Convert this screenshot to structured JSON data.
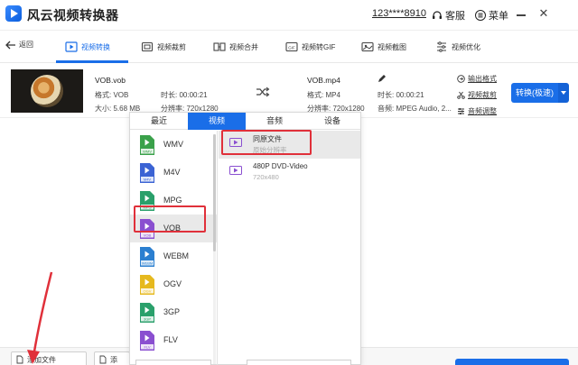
{
  "app": {
    "title": "风云视频转换器",
    "user_phone": "123****8910",
    "support_label": "客服",
    "menu_label": "菜单"
  },
  "toolbar": {
    "back_label": "返回",
    "items": [
      {
        "label": "视频转换",
        "icon": "video-convert-icon",
        "active": true
      },
      {
        "label": "视频裁剪",
        "icon": "video-crop-icon"
      },
      {
        "label": "视频合并",
        "icon": "video-merge-icon"
      },
      {
        "label": "视频转GIF",
        "icon": "gif-icon"
      },
      {
        "label": "视频截图",
        "icon": "screenshot-icon"
      },
      {
        "label": "视频优化",
        "icon": "optimize-icon"
      }
    ]
  },
  "file": {
    "source_name": "VOB.vob",
    "source_format": "格式: VOB",
    "source_duration": "时长: 00:00:21",
    "source_size": "大小: 5.68 MB",
    "source_resolution": "分辨率: 720x1280",
    "target_name": "VOB.mp4",
    "target_format": "格式: MP4",
    "target_duration": "时长: 00:00:21",
    "target_resolution": "分辨率: 720x1280",
    "target_audio": "音频: MPEG Audio, 2..."
  },
  "side_links": {
    "output_format": "输出格式",
    "video_crop": "视频裁剪",
    "audio_adjust": "音频调整"
  },
  "convert_button": "转换(极速)",
  "popup": {
    "tabs": [
      "最近",
      "视频",
      "音频",
      "设备"
    ],
    "active_tab": 1,
    "formats": [
      {
        "name": "WMV",
        "icon_color": "#3aa14a",
        "tag": "WMV"
      },
      {
        "name": "M4V",
        "icon_color": "#3b63d4",
        "tag": "M4V"
      },
      {
        "name": "MPG",
        "icon_color": "#2aa06b",
        "tag": "MPG"
      },
      {
        "name": "VOB",
        "icon_color": "#8a4fd0",
        "tag": "VOB",
        "selected": true
      },
      {
        "name": "WEBM",
        "icon_color": "#2b7fd0",
        "tag": "WEBM"
      },
      {
        "name": "OGV",
        "icon_color": "#e6b91e",
        "tag": "OGV"
      },
      {
        "name": "3GP",
        "icon_color": "#2aa06b",
        "tag": "3GP"
      },
      {
        "name": "FLV",
        "icon_color": "#8a4fd0",
        "tag": "FLV"
      }
    ],
    "presets": [
      {
        "title": "同原文件",
        "subtitle": "原始分辨率",
        "selected": true
      },
      {
        "title": "480P DVD-Video",
        "subtitle": "720x480"
      }
    ]
  },
  "bottom": {
    "add_file": "添加文件",
    "add_folder": "添"
  }
}
